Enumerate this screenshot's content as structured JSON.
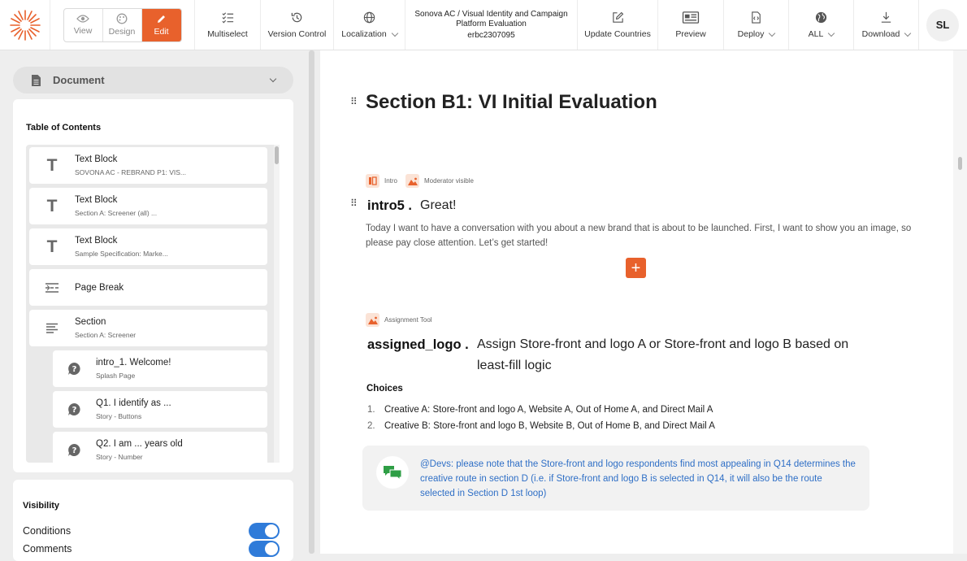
{
  "toolbar": {
    "modes": [
      {
        "label": "View",
        "icon": "eye-icon"
      },
      {
        "label": "Design",
        "icon": "palette-icon"
      },
      {
        "label": "Edit",
        "icon": "pencil-icon",
        "active": true
      }
    ],
    "multiselect": "Multiselect",
    "version_control": "Version Control",
    "localization": "Localization",
    "project_title": "Sonova AC / Visual Identity and Campaign Platform Evaluation",
    "project_code": "erbc2307095",
    "update_countries": "Update Countries",
    "preview": "Preview",
    "deploy": "Deploy",
    "all": "ALL",
    "download": "Download",
    "avatar": "SL"
  },
  "sidebar": {
    "document_label": "Document",
    "toc_title": "Table of Contents",
    "items": [
      {
        "icon": "text-block-icon",
        "title": "Text Block",
        "subtitle": "SOVONA AC - REBRAND P1: VIS..."
      },
      {
        "icon": "text-block-icon",
        "title": "Text Block",
        "subtitle": "Section A: Screener (all) ..."
      },
      {
        "icon": "text-block-icon",
        "title": "Text Block",
        "subtitle": "Sample Specification: Marke..."
      },
      {
        "icon": "page-break-icon",
        "title": "Page Break",
        "subtitle": ""
      },
      {
        "icon": "section-icon",
        "title": "Section",
        "subtitle": "Section A: Screener"
      },
      {
        "icon": "question-icon",
        "title": "intro_1. Welcome!",
        "subtitle": "Splash Page"
      },
      {
        "icon": "question-icon",
        "title": "Q1. I identify as ...",
        "subtitle": "Story - Buttons"
      },
      {
        "icon": "question-icon",
        "title": "Q2. I am ... years old",
        "subtitle": "Story - Number"
      }
    ],
    "visibility_title": "Visibility",
    "visibility_rows": [
      {
        "label": "Conditions",
        "on": true
      },
      {
        "label": "Comments",
        "on": true
      }
    ]
  },
  "main": {
    "section_title": "Section B1:  VI Initial Evaluation",
    "intro_tags": [
      "Intro",
      "Moderator visible"
    ],
    "intro_id": "intro5 .",
    "intro_text": "Great!",
    "intro_paragraph": "Today I want to have a conversation with you about a new brand that is about to be launched. First, I want to show you an image, so please pay close attention. Let’s get started!",
    "assign_tag": "Assignment Tool",
    "assign_id": "assigned_logo .",
    "assign_text": "Assign Store-front and logo A or Store-front and logo B based on least-fill logic",
    "choices_title": "Choices",
    "choices": [
      {
        "n": "1.",
        "text": "Creative A: Store-front and logo A, Website A, Out of Home A, and Direct Mail A"
      },
      {
        "n": "2.",
        "text": "Creative B: Store-front and logo B, Website B, Out of Home B, and Direct Mail A"
      }
    ],
    "note": "@Devs: please note that the Store-front and logo respondents find most appealing in Q14 determines the creative route in section D (i.e. if Store-front and logo B is selected in Q14, it will also be the route selected in Section D 1st loop)",
    "colors": {
      "accent": "#e8612c",
      "link": "#2f6fc6",
      "toggle": "#2f7bd9"
    }
  }
}
